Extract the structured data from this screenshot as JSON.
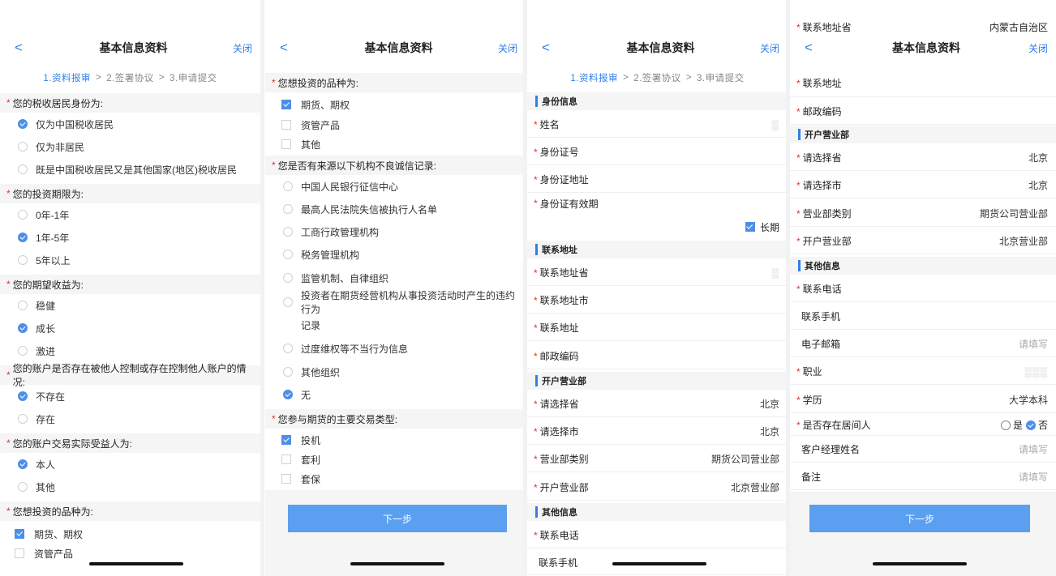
{
  "nav": {
    "title": "基本信息资料",
    "back": "<",
    "close": "关闭"
  },
  "steps": {
    "s1": "1.资料报审",
    "s2": "2.签署协议",
    "s3": "3.申请提交",
    "sep": ">"
  },
  "p1": {
    "q_tax": "您的税收居民身份为:",
    "tax_opts": [
      "仅为中国税收居民",
      "仅为非居民",
      "既是中国税收居民又是其他国家(地区)税收居民"
    ],
    "q_period": "您的投资期限为:",
    "period_opts": [
      "0年-1年",
      "1年-5年",
      "5年以上"
    ],
    "q_return": "您的期望收益为:",
    "return_opts": [
      "稳健",
      "成长",
      "激进"
    ],
    "q_control": "您的账户是否存在被他人控制或存在控制他人账户的情况:",
    "control_opts": [
      "不存在",
      "存在"
    ],
    "q_benef": "您的账户交易实际受益人为:",
    "benef_opts": [
      "本人",
      "其他"
    ],
    "q_variety": "您想投资的品种为:",
    "variety_opts": [
      "期货、期权",
      "资管产品"
    ]
  },
  "p2": {
    "q_variety": "您想投资的品种为:",
    "variety_opts": [
      "期货、期权",
      "资管产品",
      "其他"
    ],
    "q_credit": "您是否有来源以下机构不良诚信记录:",
    "credit_opts": [
      "中国人民银行征信中心",
      "最高人民法院失信被执行人名单",
      "工商行政管理机构",
      "税务管理机构",
      "监管机制、自律组织",
      "投资者在期货经营机构从事投资活动时产生的违约行为",
      "记录",
      "过度维权等不当行为信息",
      "其他组织",
      "无"
    ],
    "q_trade": "您参与期货的主要交易类型:",
    "trade_opts": [
      "投机",
      "套利",
      "套保"
    ],
    "next": "下一步"
  },
  "p3": {
    "sec_id": "身份信息",
    "name": "姓名",
    "id_no": "身份证号",
    "id_addr": "身份证地址",
    "id_valid": "身份证有效期",
    "long_term": "长期",
    "sec_contact": "联系地址",
    "prov": "联系地址省",
    "city": "联系地址市",
    "addr": "联系地址",
    "zip": "邮政编码",
    "sec_branch": "开户营业部",
    "sel_prov": "请选择省",
    "sel_prov_val": "北京",
    "sel_city": "请选择市",
    "sel_city_val": "北京",
    "branch_type": "营业部类别",
    "branch_type_val": "期货公司营业部",
    "branch": "开户营业部",
    "branch_val": "北京营业部",
    "sec_other": "其他信息",
    "phone": "联系电话",
    "mobile": "联系手机"
  },
  "p4": {
    "prov": "联系地址省",
    "prov_val": "内蒙古自治区",
    "addr": "联系地址",
    "zip": "邮政编码",
    "sec_branch": "开户营业部",
    "sel_prov": "请选择省",
    "sel_prov_val": "北京",
    "sel_city": "请选择市",
    "sel_city_val": "北京",
    "branch_type": "营业部类别",
    "branch_type_val": "期货公司营业部",
    "branch": "开户营业部",
    "branch_val": "北京营业部",
    "sec_other": "其他信息",
    "phone": "联系电话",
    "mobile": "联系手机",
    "email": "电子邮箱",
    "email_ph": "请填写",
    "job": "职业",
    "edu": "学历",
    "edu_val": "大学本科",
    "broker": "是否存在居间人",
    "yes": "是",
    "no": "否",
    "manager": "客户经理姓名",
    "manager_ph": "请填写",
    "remark": "备注",
    "remark_ph": "请填写",
    "next": "下一步"
  },
  "colors": {
    "accent": "#2f7fe6",
    "button": "#5b9ff0",
    "required": "#e0342d"
  }
}
